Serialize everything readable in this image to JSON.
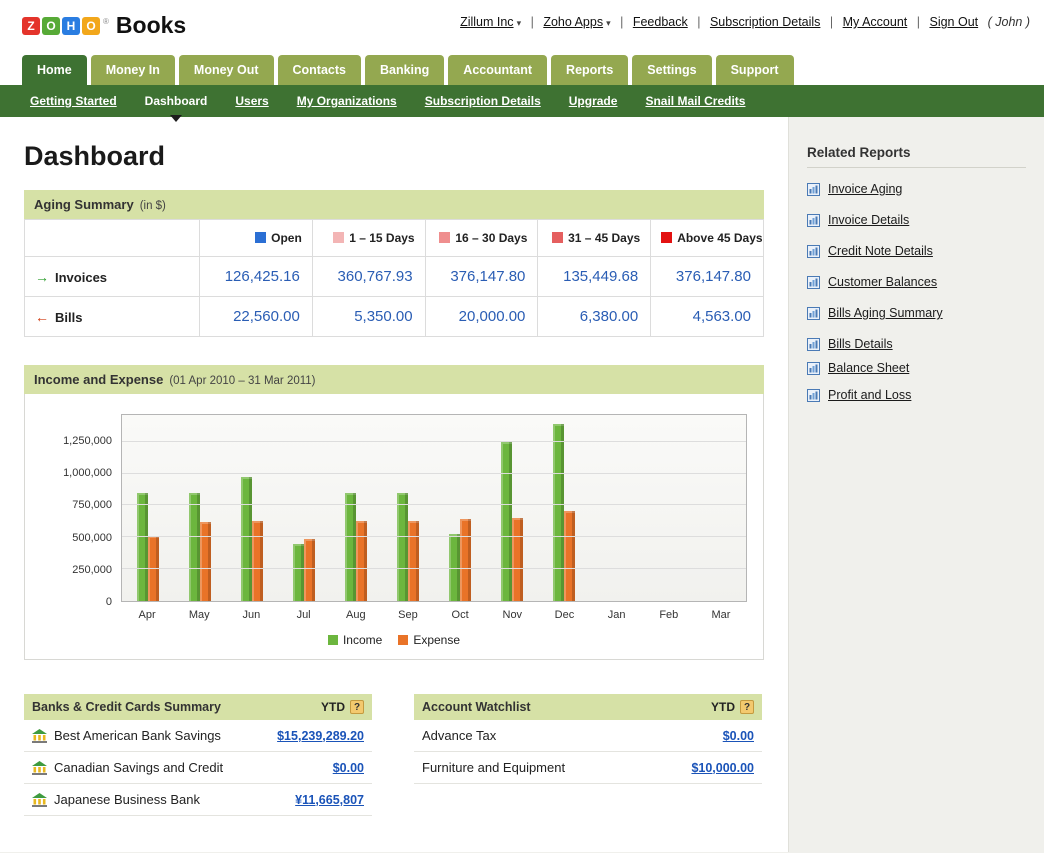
{
  "header": {
    "logo_letters": [
      "Z",
      "O",
      "H",
      "O"
    ],
    "logo_reg": "®",
    "brand": "Books",
    "links": [
      {
        "label": "Zillum Inc",
        "dropdown": true
      },
      {
        "label": "Zoho Apps",
        "dropdown": true
      },
      {
        "label": "Feedback"
      },
      {
        "label": "Subscription Details"
      },
      {
        "label": "My Account"
      },
      {
        "label": "Sign Out"
      }
    ],
    "user": "( John )"
  },
  "nav": {
    "tabs": [
      {
        "label": "Home",
        "active": true
      },
      {
        "label": "Money In"
      },
      {
        "label": "Money Out"
      },
      {
        "label": "Contacts"
      },
      {
        "label": "Banking"
      },
      {
        "label": "Accountant"
      },
      {
        "label": "Reports"
      },
      {
        "label": "Settings"
      },
      {
        "label": "Support"
      }
    ]
  },
  "subnav": {
    "items": [
      {
        "label": "Getting Started"
      },
      {
        "label": "Dashboard",
        "active": true
      },
      {
        "label": "Users"
      },
      {
        "label": "My Organizations"
      },
      {
        "label": "Subscription Details"
      },
      {
        "label": "Upgrade"
      },
      {
        "label": "Snail Mail Credits"
      }
    ]
  },
  "page": {
    "title": "Dashboard"
  },
  "aging": {
    "title": "Aging Summary",
    "subtitle": "(in $)",
    "legend": [
      {
        "label": "Open",
        "color": "#2b6fd4"
      },
      {
        "label": "1 – 15 Days",
        "color": "#f3b5b5"
      },
      {
        "label": "16 – 30 Days",
        "color": "#ef8e8e"
      },
      {
        "label": "31 – 45 Days",
        "color": "#e55f5f"
      },
      {
        "label": "Above 45 Days",
        "color": "#e31212"
      }
    ],
    "rows": [
      {
        "label": "Invoices",
        "values": [
          "126,425.16",
          "360,767.93",
          "376,147.80",
          "135,449.68",
          "376,147.80"
        ]
      },
      {
        "label": "Bills",
        "values": [
          "22,560.00",
          "5,350.00",
          "20,000.00",
          "6,380.00",
          "4,563.00"
        ]
      }
    ]
  },
  "chart_section": {
    "title": "Income and Expense",
    "subtitle": "(01 Apr 2010 – 31 Mar 2011)"
  },
  "chart_data": {
    "type": "bar",
    "title": "Income and Expense",
    "xlabel": "",
    "ylabel": "",
    "categories": [
      "Apr",
      "May",
      "Jun",
      "Jul",
      "Aug",
      "Sep",
      "Oct",
      "Nov",
      "Dec",
      "Jan",
      "Feb",
      "Mar"
    ],
    "series": [
      {
        "name": "Income",
        "color": "#6cb63e",
        "values": [
          850000,
          850000,
          975000,
          450000,
          850000,
          850000,
          525000,
          1250000,
          1390000,
          0,
          0,
          0
        ]
      },
      {
        "name": "Expense",
        "color": "#e97328",
        "values": [
          510000,
          620000,
          630000,
          490000,
          630000,
          630000,
          640000,
          655000,
          710000,
          0,
          0,
          0
        ]
      }
    ],
    "y_ticks": [
      0,
      250000,
      500000,
      750000,
      1000000,
      1250000
    ],
    "y_tick_labels": [
      "0",
      "250,000",
      "500,000",
      "750,000",
      "1,000,000",
      "1,250,000"
    ],
    "ymax": 1460000,
    "grid": true,
    "legend_position": "bottom"
  },
  "banks": {
    "title": "Banks & Credit Cards Summary",
    "ytd": "YTD",
    "help": "?",
    "rows": [
      {
        "name": "Best American Bank Savings",
        "amount": "$15,239,289.20"
      },
      {
        "name": "Canadian Savings and Credit",
        "amount": "$0.00"
      },
      {
        "name": "Japanese Business Bank",
        "amount": "¥11,665,807"
      }
    ]
  },
  "watchlist": {
    "title": "Account Watchlist",
    "ytd": "YTD",
    "help": "?",
    "rows": [
      {
        "name": "Advance Tax",
        "amount": "$0.00"
      },
      {
        "name": "Furniture and Equipment",
        "amount": "$10,000.00"
      }
    ]
  },
  "related": {
    "title": "Related Reports",
    "items": [
      "Invoice Aging",
      "Invoice Details",
      "Credit Note Details",
      "Customer Balances",
      "Bills Aging Summary",
      "Bills Details",
      "Balance Sheet",
      "Profit and Loss"
    ]
  }
}
